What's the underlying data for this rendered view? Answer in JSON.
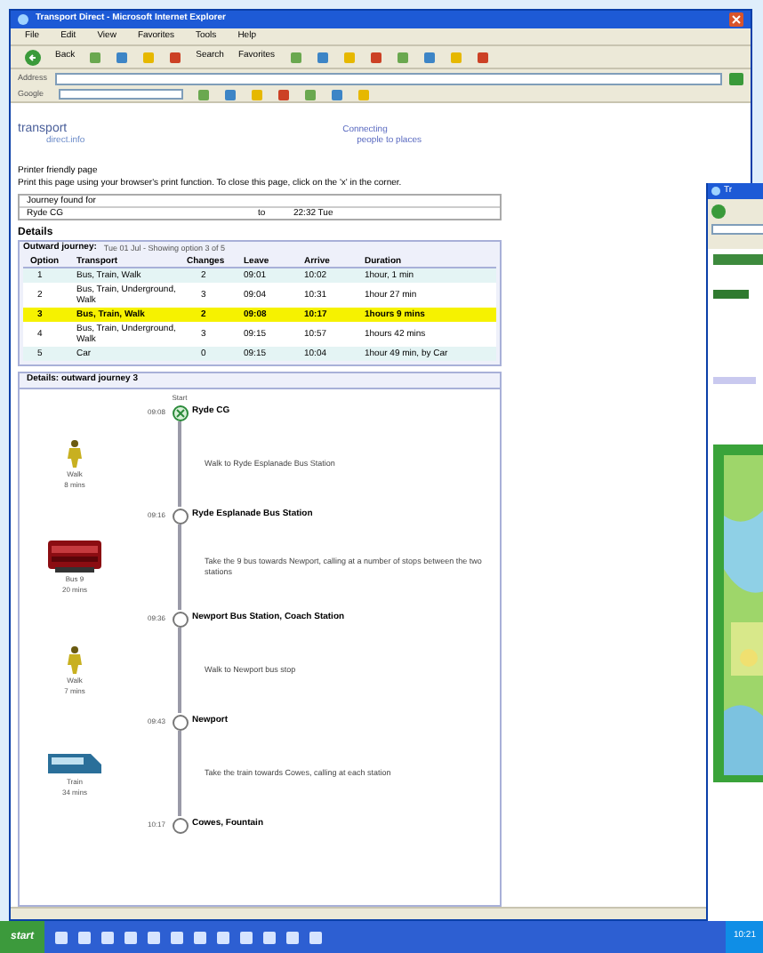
{
  "main_window": {
    "title": "Transport Direct - Microsoft Internet Explorer",
    "menu": [
      "File",
      "Edit",
      "View",
      "Favorites",
      "Tools",
      "Help"
    ],
    "toolbar": [
      "Back",
      "Search",
      "Favorites"
    ],
    "address_label": "Address",
    "links_label": "Google",
    "logo": {
      "line_1": "transport",
      "line_2": "direct.info"
    },
    "tagline": {
      "line_1": "Connecting",
      "line_2": "people to places"
    },
    "intro": [
      "Printer friendly page",
      "Print this page using your browser's print function. To close this page, click on the 'x' in the corner."
    ],
    "journey_found": {
      "heading": "Journey found for",
      "from": "Ryde CG",
      "arrow": "to",
      "time": "22:32 Tue"
    },
    "details_heading": "Details",
    "outward": {
      "title": "Outward journey:",
      "subtitle": "Tue 01 Jul - Showing option 3 of 5",
      "columns": [
        "Option",
        "Transport",
        "Changes",
        "Leave",
        "Arrive",
        "Duration"
      ],
      "rows": [
        {
          "option": "1",
          "transport": "Bus, Train, Walk",
          "changes": "2",
          "leave": "09:01",
          "arrive": "10:02",
          "duration": "1hour, 1 min",
          "selected": false
        },
        {
          "option": "2",
          "transport": "Bus, Train, Underground, Walk",
          "changes": "3",
          "leave": "09:04",
          "arrive": "10:31",
          "duration": "1hour 27 min",
          "selected": false
        },
        {
          "option": "3",
          "transport": "Bus, Train, Walk",
          "changes": "2",
          "leave": "09:08",
          "arrive": "10:17",
          "duration": "1hours 9 mins",
          "selected": true
        },
        {
          "option": "4",
          "transport": "Bus, Train, Underground, Walk",
          "changes": "3",
          "leave": "09:15",
          "arrive": "10:57",
          "duration": "1hours 42 mins",
          "selected": false
        },
        {
          "option": "5",
          "transport": "Car",
          "changes": "0",
          "leave": "09:15",
          "arrive": "10:04",
          "duration": "1hour 49 min, by Car",
          "selected": false
        }
      ]
    },
    "details_box": {
      "title": "Details: outward journey 3",
      "start_label": "Start",
      "stops": [
        {
          "time": "09:08",
          "name": "Ryde CG",
          "kind": "start"
        },
        {
          "time": "09:16",
          "name": "Ryde Esplanade Bus Station",
          "kind": "stop"
        },
        {
          "time": "09:36",
          "name": "Newport Bus Station, Coach Station",
          "kind": "stop"
        },
        {
          "time": "09:43",
          "name": "Newport",
          "kind": "stop"
        },
        {
          "time": "10:17",
          "name": "Cowes, Fountain",
          "kind": "stop"
        }
      ],
      "legs": [
        {
          "kind": "walk",
          "mode": "Walk",
          "duration": "8 mins",
          "instruction": "Walk to Ryde Esplanade Bus Station"
        },
        {
          "kind": "bus",
          "mode": "Bus 9",
          "duration": "20 mins",
          "instruction": "Take the 9 bus towards Newport, calling at a number of stops between the two stations"
        },
        {
          "kind": "walk",
          "mode": "Walk",
          "duration": "7 mins",
          "instruction": "Walk to Newport bus stop"
        },
        {
          "kind": "train",
          "mode": "Train",
          "duration": "34 mins",
          "instruction": "Take the train towards Cowes, calling at each station"
        }
      ]
    }
  },
  "second_window": {
    "title": "Tr"
  },
  "taskbar": {
    "start": "start",
    "clock": "10:21"
  }
}
